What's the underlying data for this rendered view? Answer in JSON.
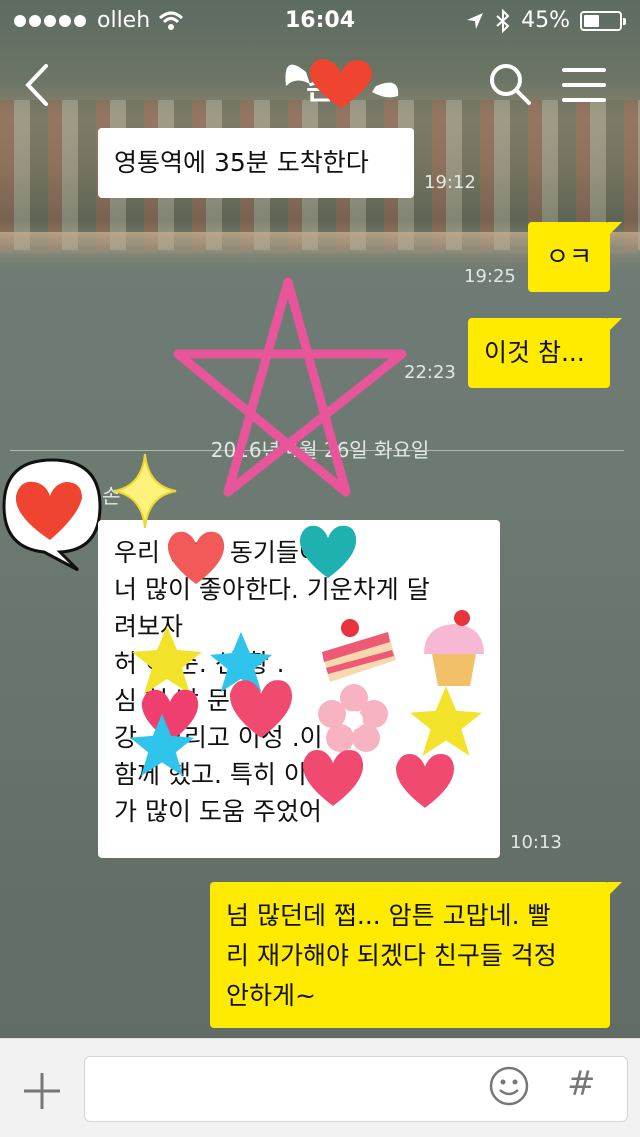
{
  "status_bar": {
    "carrier": "olleh",
    "time": "16:04",
    "battery": "45%",
    "battery_level": 0.45
  },
  "header": {
    "title": "손"
  },
  "messages": [
    {
      "text": "영통역에 35분 도착한다",
      "time": "19:12",
      "sender": "other"
    },
    {
      "text": "ㅇㅋ",
      "time": "19:25",
      "sender": "me"
    },
    {
      "text": "이것 참...",
      "time": "22:23",
      "sender": "me"
    }
  ],
  "date_divider": "2016년 4월 26일 화요일",
  "friend_name": "손",
  "long_message": {
    "lines": [
      "우리 동기. 동기들이",
      "너 많이 좋아한다.  기운차게 달",
      "려보자",
      "허 이 준. 신 황 .",
      "심 허 박 문 .",
      "강 . 그리고 이성 .이  이",
      "함께 했고. 특히  이.  이",
      "가 많이 도움 주었어"
    ],
    "time": "10:13"
  },
  "reply": {
    "lines": [
      "넘 많던데 쩝... 암튼 고맙네. 빨",
      "리 재가해야 되겠다 친구들 걱정",
      "안하게~"
    ]
  },
  "input": {
    "placeholder": ""
  },
  "input_bar": {
    "hash": "#"
  },
  "colors": {
    "my_bubble": "#ffeb00",
    "other_bubble": "#ffffff",
    "star": "#e8559a",
    "heart": "#ee4430"
  }
}
